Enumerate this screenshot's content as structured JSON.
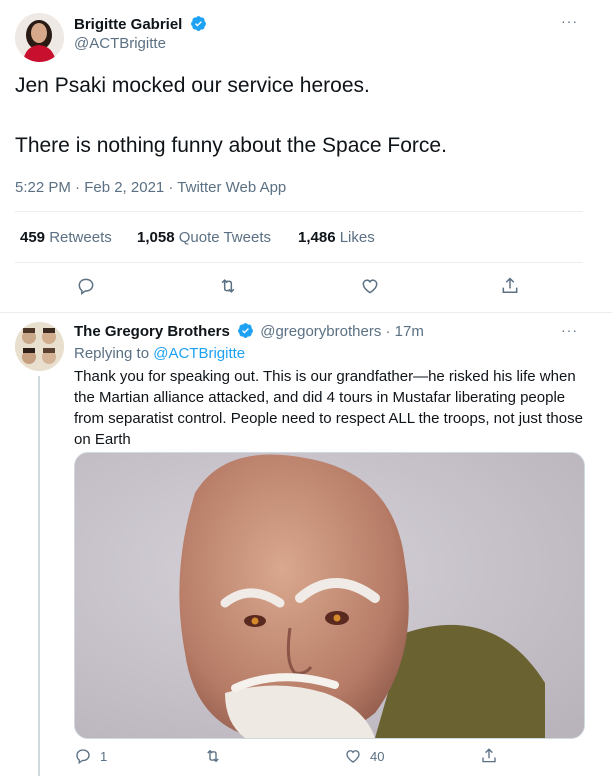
{
  "main_tweet": {
    "display_name": "Brigitte Gabriel",
    "handle": "@ACTBrigitte",
    "text_line1": "Jen Psaki mocked our service heroes.",
    "text_line2": "There is nothing funny about the Space Force.",
    "timestamp": "5:22 PM · Feb 2, 2021 · Twitter Web App",
    "stats": {
      "retweets_count": "459",
      "retweets_label": "Retweets",
      "quotes_count": "1,058",
      "quotes_label": "Quote Tweets",
      "likes_count": "1,486",
      "likes_label": "Likes"
    },
    "more_glyph": "···"
  },
  "reply_tweet": {
    "display_name": "The Gregory Brothers",
    "handle": "@gregorybrothers",
    "time_ago": "· 17m",
    "replying_to_label": "Replying to",
    "replying_to_handle": "@ACTBrigitte",
    "text": "Thank you for speaking out. This is our grandfather—he risked his life when the Martian alliance attacked, and did 4 tours in Mustafar liberating people from separatist control. People need to respect ALL the troops, not just those on Earth",
    "reply_count": "1",
    "like_count": "40",
    "more_glyph": "···"
  },
  "colors": {
    "accent": "#1da1f2",
    "text": "#0f1419",
    "muted": "#5b7083",
    "divider": "#ebeef0"
  },
  "icons": [
    "verified-badge-icon",
    "reply-icon",
    "retweet-icon",
    "like-icon",
    "share-icon",
    "more-icon"
  ]
}
